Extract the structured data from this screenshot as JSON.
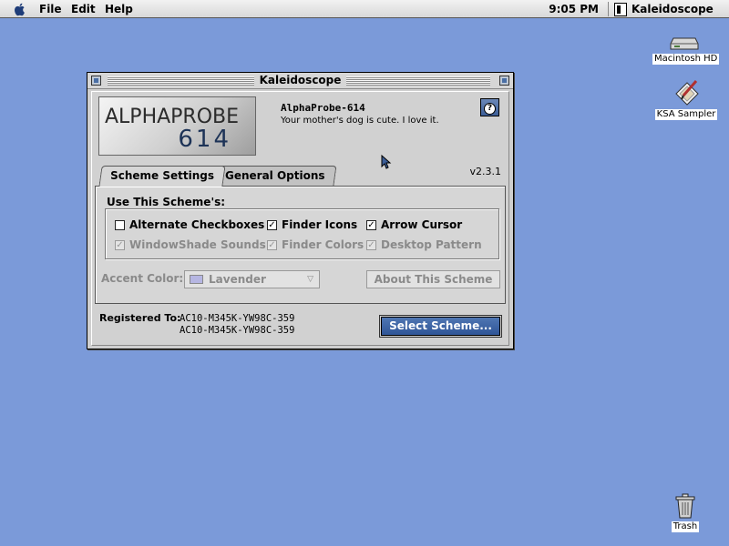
{
  "menubar": {
    "apple_icon": "apple-logo-icon",
    "items": [
      "File",
      "Edit",
      "Help"
    ],
    "clock": "9:05 PM",
    "app_name": "Kaleidoscope"
  },
  "desktop": {
    "icons": [
      {
        "label": "Macintosh HD",
        "icon": "hard-drive-icon"
      },
      {
        "label": "KSA Sampler",
        "icon": "application-icon"
      },
      {
        "label": "Trash",
        "icon": "trash-icon"
      }
    ],
    "background_color": "#7b9ad9"
  },
  "window": {
    "title": "Kaleidoscope",
    "logo": {
      "top": "ALPHAPROBE",
      "num": "614"
    },
    "scheme_name": "AlphaProbe-614",
    "scheme_desc": "Your mother's dog is cute. I love it.",
    "help_label": "?",
    "version": "v2.3.1",
    "tabs": [
      {
        "label": "Scheme Settings",
        "active": true
      },
      {
        "label": "General Options",
        "active": false
      }
    ],
    "group_label": "Use This Scheme's:",
    "checkboxes": [
      {
        "label": "Alternate Checkboxes",
        "checked": false,
        "enabled": true
      },
      {
        "label": "Finder Icons",
        "checked": true,
        "enabled": true
      },
      {
        "label": "Arrow Cursor",
        "checked": true,
        "enabled": true
      },
      {
        "label": "WindowShade Sounds",
        "checked": true,
        "enabled": false
      },
      {
        "label": "Finder Colors",
        "checked": true,
        "enabled": false
      },
      {
        "label": "Desktop Pattern",
        "checked": true,
        "enabled": false
      }
    ],
    "accent_label": "Accent Color:",
    "accent_value": "Lavender",
    "about_button": "About This Scheme",
    "registered_label": "Registered To:",
    "registered_values": [
      "AC10-M345K-YW98C-359",
      "AC10-M345K-YW98C-359"
    ],
    "select_button": "Select Scheme..."
  },
  "colors": {
    "accent": "#2f5597",
    "window_bg": "#d1d1d1"
  }
}
